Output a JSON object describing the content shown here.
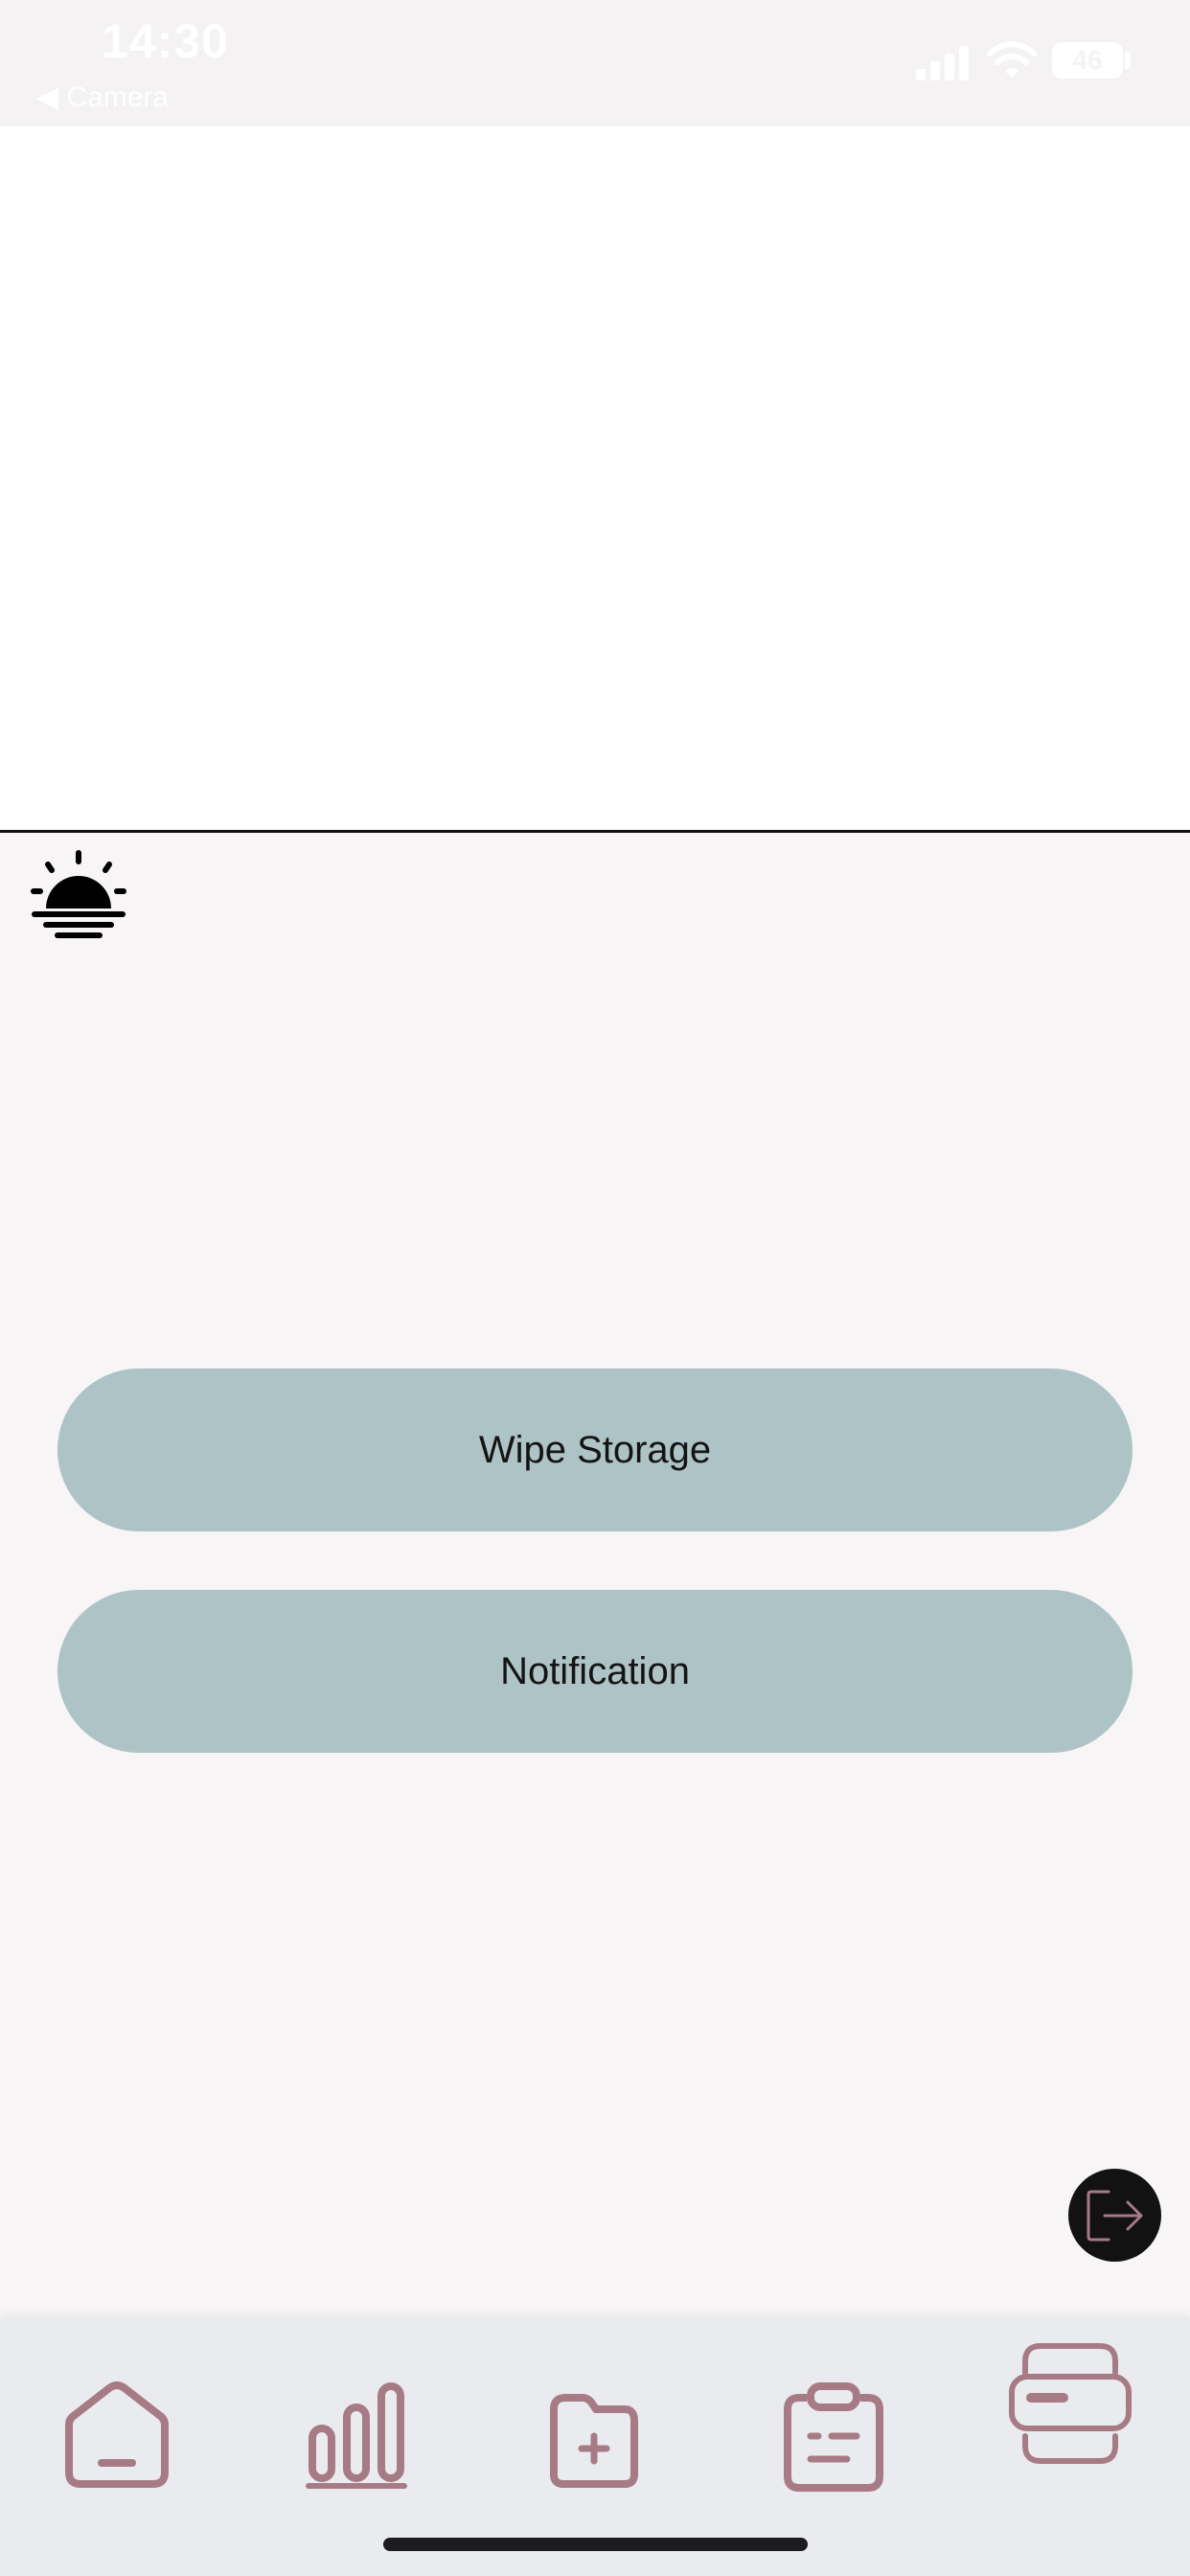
{
  "status_bar": {
    "time": "14:30",
    "back_label": "◀ Camera",
    "battery": "46",
    "icons": [
      "cellular-signal-icon",
      "wifi-icon",
      "battery-icon"
    ]
  },
  "settings": {
    "theme_icon": "sunset-icon",
    "wipe_storage_label": "Wipe Storage",
    "notification_label": "Notification",
    "logout_icon": "logout-icon"
  },
  "tab_bar": {
    "items": [
      {
        "name": "home",
        "icon": "home-icon"
      },
      {
        "name": "stats",
        "icon": "bar-chart-icon"
      },
      {
        "name": "add-folder",
        "icon": "folder-plus-icon"
      },
      {
        "name": "clipboard",
        "icon": "clipboard-icon"
      },
      {
        "name": "card",
        "icon": "card-icon"
      }
    ]
  },
  "colors": {
    "background": "#f7f5f6",
    "button": "#aec3c6",
    "tab_icon": "#a77b85",
    "tab_bar": "#e9ebee"
  }
}
